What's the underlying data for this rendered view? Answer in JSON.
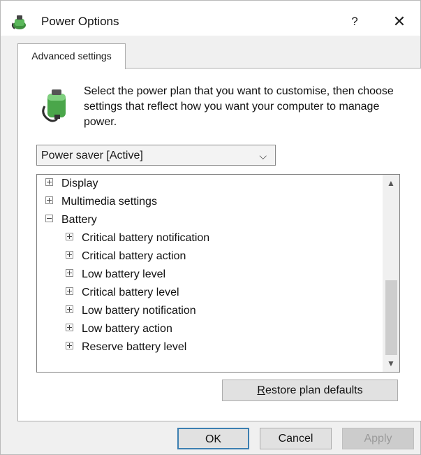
{
  "window": {
    "title": "Power Options",
    "help_label": "?",
    "close_label": "✕",
    "icon": "power-options-icon"
  },
  "tab": {
    "label": "Advanced settings"
  },
  "description": "Select the power plan that you want to customise, then choose settings that reflect how you want your computer to manage power.",
  "plan_select": {
    "value": "Power saver [Active]",
    "chevron": "⌵"
  },
  "tree": {
    "items": [
      {
        "label": "Display",
        "expanded": false,
        "level": 0
      },
      {
        "label": "Multimedia settings",
        "expanded": false,
        "level": 0
      },
      {
        "label": "Battery",
        "expanded": true,
        "level": 0
      },
      {
        "label": "Critical battery notification",
        "expanded": false,
        "level": 1
      },
      {
        "label": "Critical battery action",
        "expanded": false,
        "level": 1
      },
      {
        "label": "Low battery level",
        "expanded": false,
        "level": 1
      },
      {
        "label": "Critical battery level",
        "expanded": false,
        "level": 1
      },
      {
        "label": "Low battery notification",
        "expanded": false,
        "level": 1
      },
      {
        "label": "Low battery action",
        "expanded": false,
        "level": 1
      },
      {
        "label": "Reserve battery level",
        "expanded": false,
        "level": 1
      }
    ],
    "scroll_up": "▲",
    "scroll_down": "▼"
  },
  "buttons": {
    "restore_prefix": "R",
    "restore_rest": "estore plan defaults",
    "ok": "OK",
    "cancel": "Cancel",
    "apply": "Apply"
  },
  "colors": {
    "accent_border": "#3c7fb1",
    "dialog_background": "#f0f0f0"
  }
}
